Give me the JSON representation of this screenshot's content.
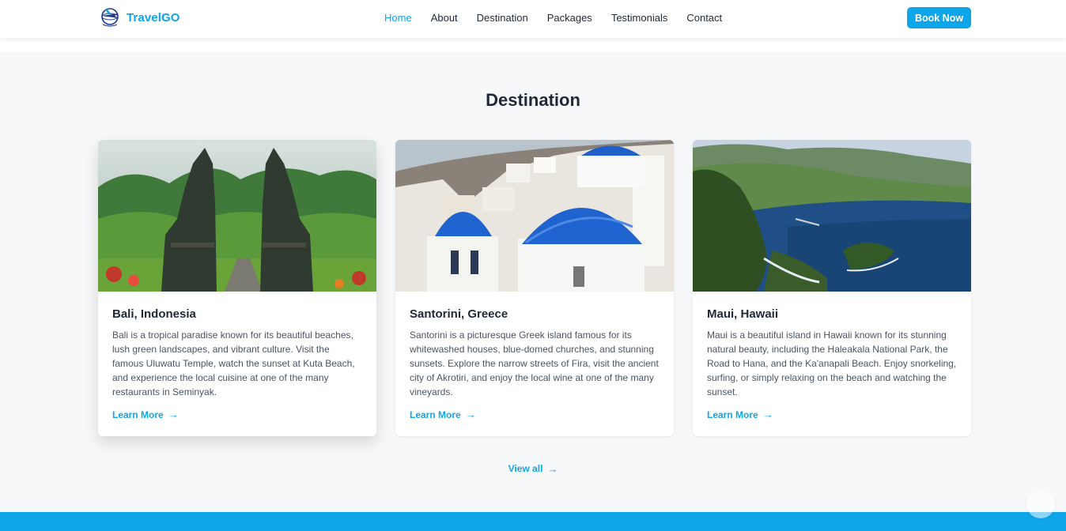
{
  "brand": {
    "name": "TravelGO",
    "logo_icon": "plane-globe-icon"
  },
  "nav": {
    "items": [
      {
        "label": "Home",
        "active": true
      },
      {
        "label": "About"
      },
      {
        "label": "Destination"
      },
      {
        "label": "Packages"
      },
      {
        "label": "Testimonials"
      },
      {
        "label": "Contact"
      }
    ],
    "cta_label": "Book Now"
  },
  "section": {
    "title": "Destination"
  },
  "cards": [
    {
      "title": "Bali, Indonesia",
      "description": "Bali is a tropical paradise known for its beautiful beaches, lush green landscapes, and vibrant culture. Visit the famous Uluwatu Temple, watch the sunset at Kuta Beach, and experience the local cuisine at one of the many restaurants in Seminyak.",
      "link_label": "Learn More",
      "image": "temple-gate-photo"
    },
    {
      "title": "Santorini, Greece",
      "description": "Santorini is a picturesque Greek island famous for its whitewashed houses, blue-domed churches, and stunning sunsets. Explore the narrow streets of Fira, visit the ancient city of Akrotiri, and enjoy the local wine at one of the many vineyards.",
      "link_label": "Learn More",
      "image": "blue-dome-photo"
    },
    {
      "title": "Maui, Hawaii",
      "description": "Maui is a beautiful island in Hawaii known for its stunning natural beauty, including the Haleakala National Park, the Road to Hana, and the Ka'anapali Beach. Enjoy snorkeling, surfing, or simply relaxing on the beach and watching the sunset.",
      "link_label": "Learn More",
      "image": "coastline-photo"
    }
  ],
  "view_all_label": "View all",
  "arrow_glyph": "→",
  "colors": {
    "accent": "#0ea5e9",
    "text": "#1f2937",
    "muted": "#4b5563",
    "background": "#f7f8fa"
  }
}
